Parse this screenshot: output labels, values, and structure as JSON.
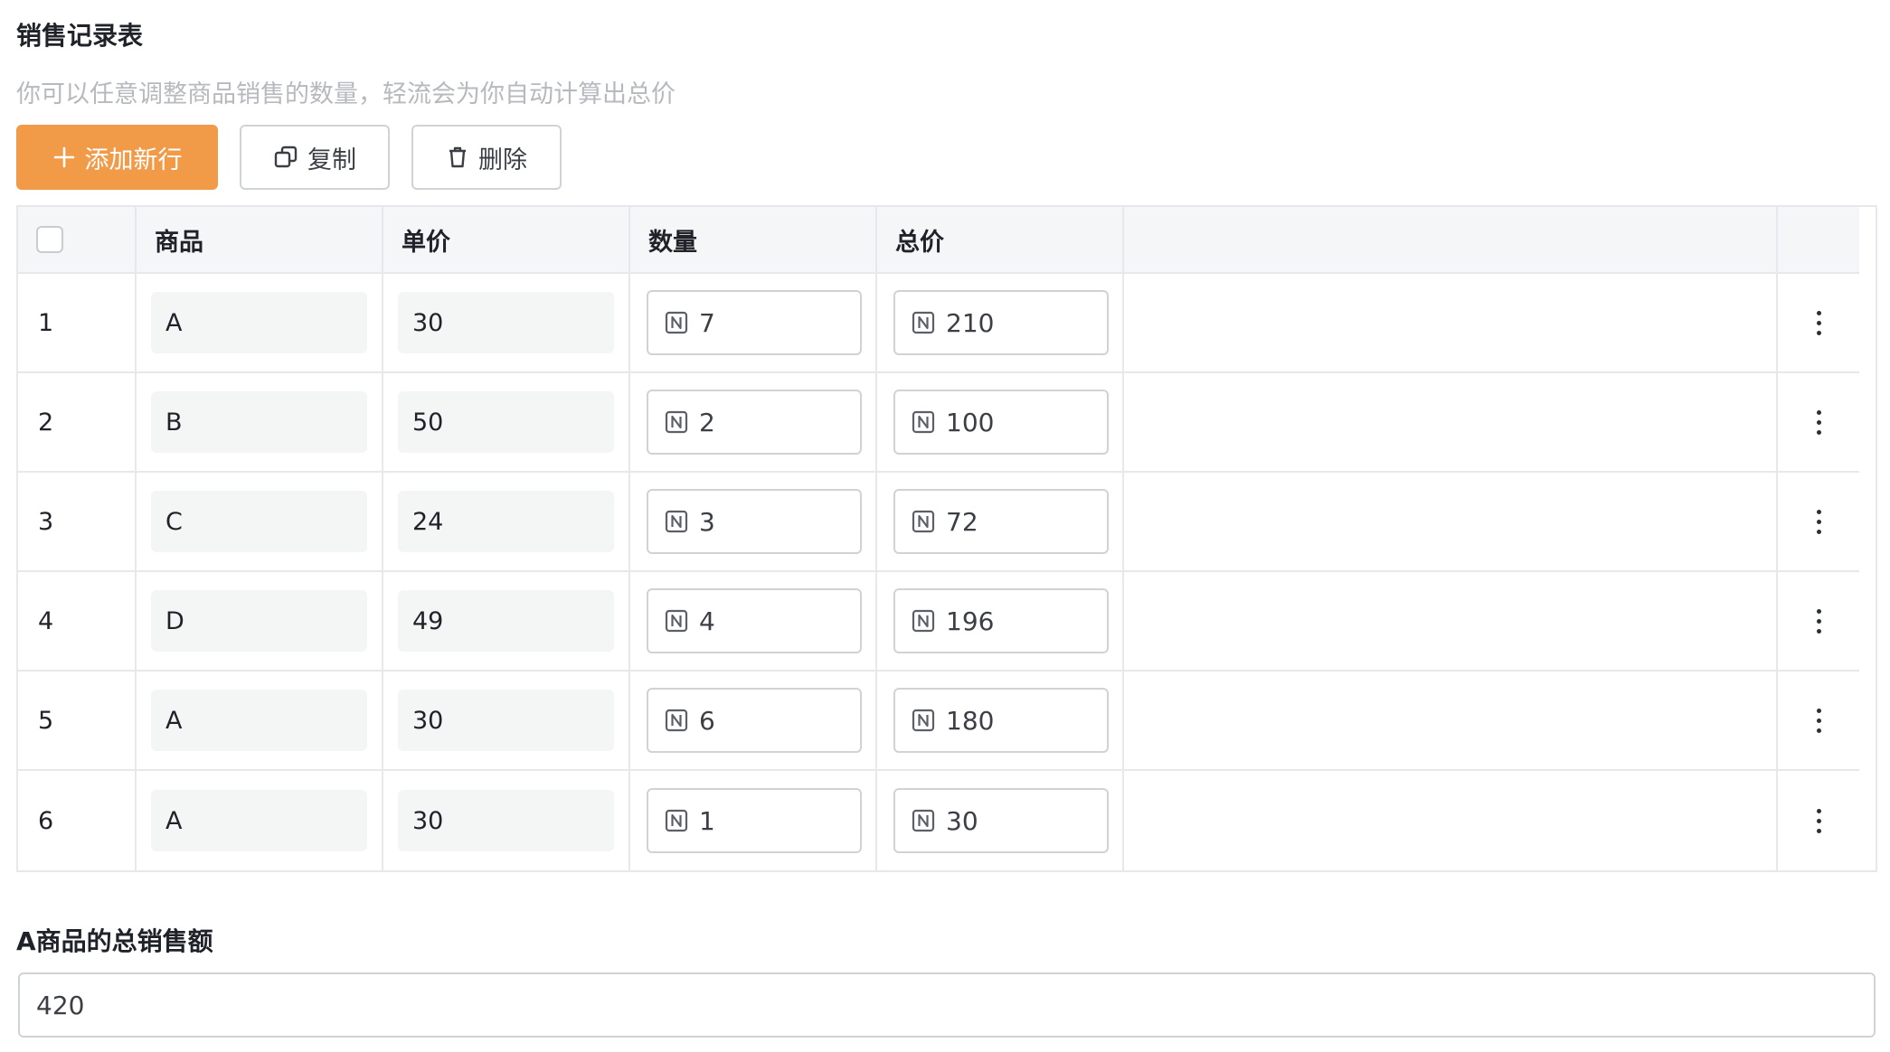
{
  "form": {
    "title": "销售记录表",
    "description": "你可以任意调整商品销售的数量，轻流会为你自动计算出总价"
  },
  "toolbar": {
    "add_label": "添加新行",
    "copy_label": "复制",
    "delete_label": "删除"
  },
  "colors": {
    "primary": "#f19a48",
    "border": "#e6e8eb",
    "cell_bg": "#f4f5f5"
  },
  "icons": {
    "add": "plus-icon",
    "copy": "copy-icon",
    "delete": "trash-icon",
    "number": "number-field-icon",
    "row_menu": "more-vertical-icon"
  },
  "table": {
    "columns": [
      "商品",
      "单价",
      "数量",
      "总价"
    ],
    "rows": [
      {
        "index": "1",
        "product": "A",
        "price": "30",
        "qty": "7",
        "total": "210"
      },
      {
        "index": "2",
        "product": "B",
        "price": "50",
        "qty": "2",
        "total": "100"
      },
      {
        "index": "3",
        "product": "C",
        "price": "24",
        "qty": "3",
        "total": "72"
      },
      {
        "index": "4",
        "product": "D",
        "price": "49",
        "qty": "4",
        "total": "196"
      },
      {
        "index": "5",
        "product": "A",
        "price": "30",
        "qty": "6",
        "total": "180"
      },
      {
        "index": "6",
        "product": "A",
        "price": "30",
        "qty": "1",
        "total": "30"
      }
    ]
  },
  "summary": {
    "label": "A商品的总销售额",
    "value": "420"
  }
}
